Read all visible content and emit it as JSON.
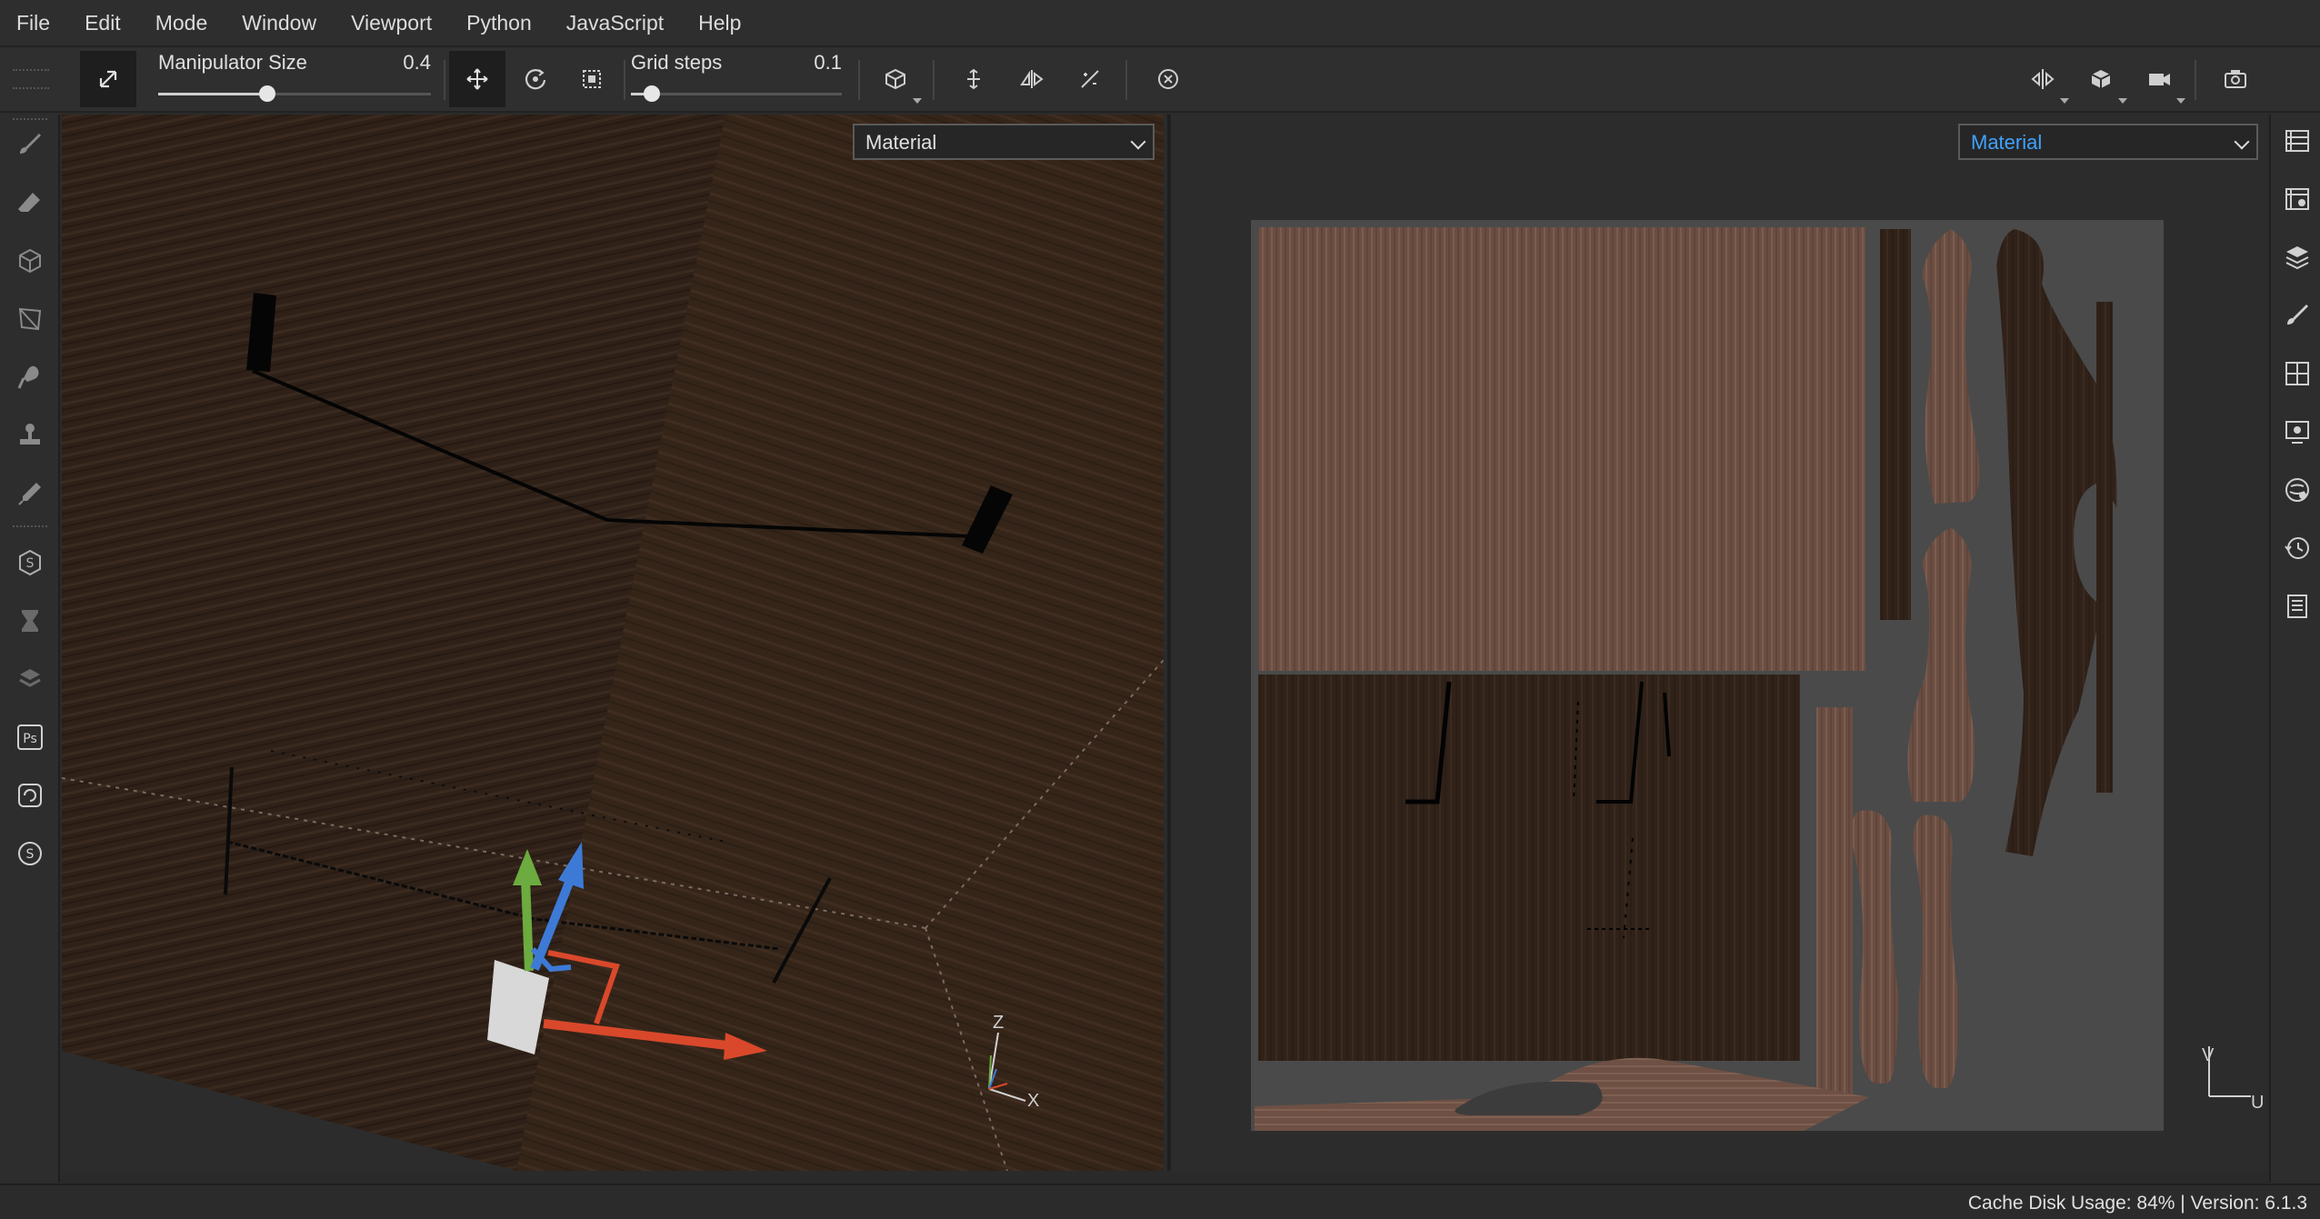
{
  "menu": [
    "File",
    "Edit",
    "Mode",
    "Window",
    "Viewport",
    "Python",
    "JavaScript",
    "Help"
  ],
  "toolbar": {
    "manipulator_size": {
      "label": "Manipulator Size",
      "value": "0.4",
      "fraction": 0.4
    },
    "grid_steps": {
      "label": "Grid steps",
      "value": "0.1",
      "fraction": 0.1
    }
  },
  "viewport3d": {
    "dropdown": "Material",
    "axis_labels": {
      "z": "Z",
      "x": "X"
    }
  },
  "viewport2d": {
    "dropdown": "Material",
    "axis_labels": {
      "v": "V",
      "u": "U"
    }
  },
  "status": {
    "text": "Cache Disk Usage: 84% | Version: 6.1.3"
  },
  "colors": {
    "accent": "#3fa3ff",
    "gizmo_x": "#d9482b",
    "gizmo_y": "#6cab3f",
    "gizmo_z": "#3d7ad6",
    "wood_dark": "#2f2118",
    "wood_light": "#6b4e42"
  },
  "icons": {
    "toolbar": [
      "transform-icon",
      "move-icon",
      "rotate-icon",
      "scale-icon",
      "cube-icon",
      "snap-icon",
      "symmetry-icon",
      "slash-icon",
      "clear-icon",
      "mirror-icon",
      "cube-view-icon",
      "camera-icon",
      "screenshot-icon"
    ],
    "left_rail": [
      "paint-brush-icon",
      "eraser-icon",
      "projection-icon",
      "polygon-fill-icon",
      "smudge-icon",
      "clone-stamp-icon",
      "color-picker-icon",
      "substance-icon",
      "bake-icon",
      "share-icon",
      "photoshop-icon",
      "sync-icon",
      "substance-source-icon"
    ],
    "right_rail": [
      "texture-set-list-icon",
      "texture-set-settings-icon",
      "layers-icon",
      "properties-icon",
      "display-settings-icon",
      "viewer-settings-icon",
      "shader-settings-icon",
      "history-icon",
      "log-icon"
    ]
  }
}
